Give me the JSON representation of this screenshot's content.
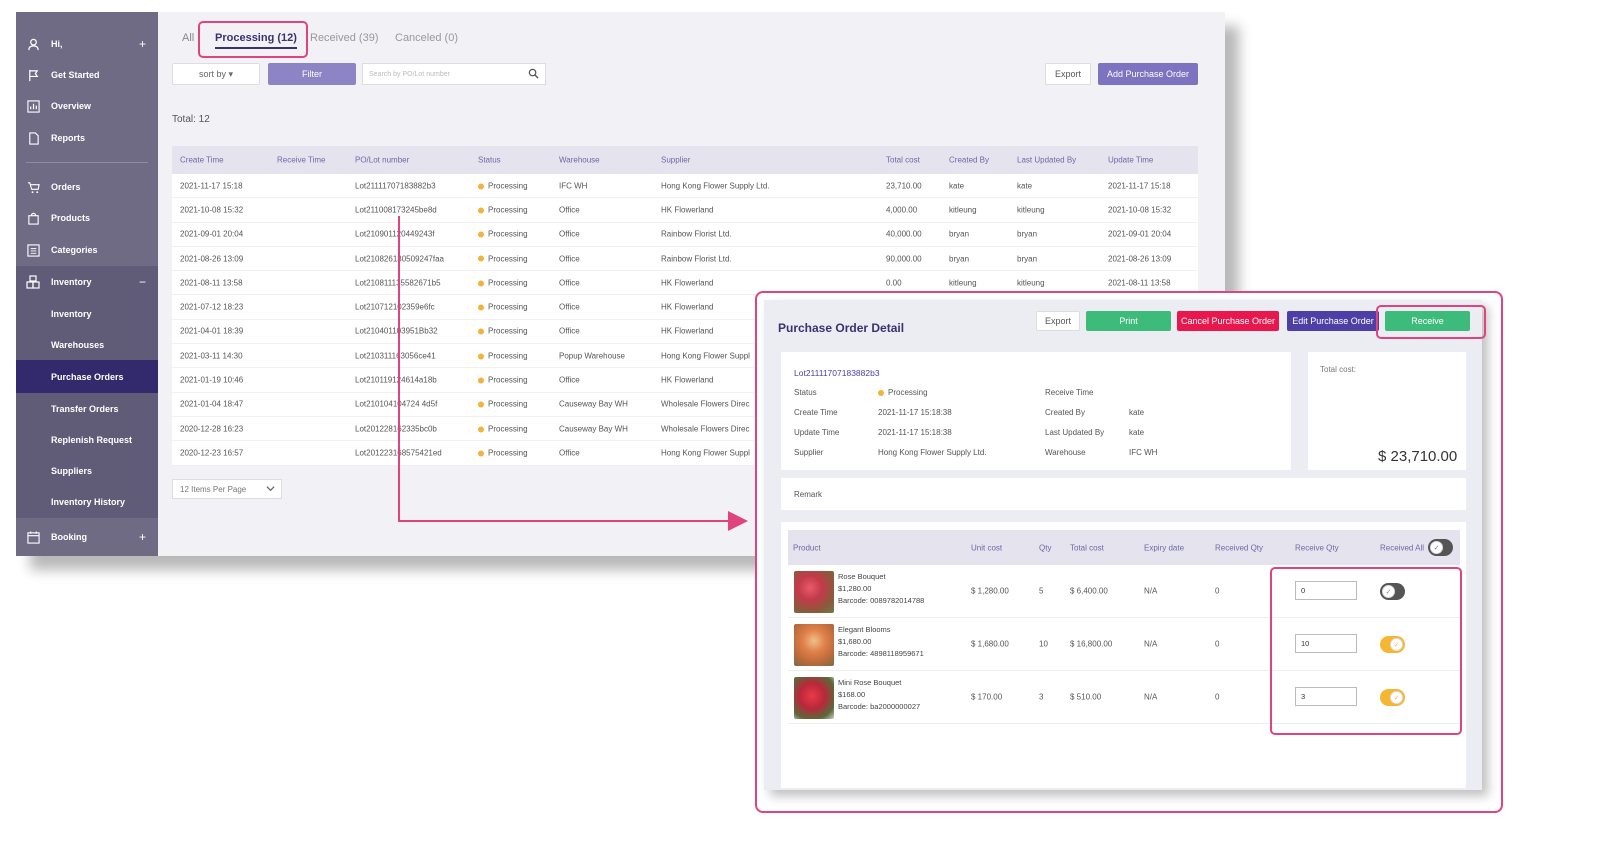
{
  "sidebar": {
    "items": [
      {
        "label": "Hi,",
        "icon": "user-icon",
        "plus": "+"
      },
      {
        "label": "Get Started",
        "icon": "flag-icon"
      },
      {
        "label": "Overview",
        "icon": "chart-icon"
      },
      {
        "label": "Reports",
        "icon": "document-icon"
      },
      {
        "label": "Orders",
        "icon": "cart-icon"
      },
      {
        "label": "Products",
        "icon": "bag-icon"
      },
      {
        "label": "Categories",
        "icon": "list-icon"
      },
      {
        "label": "Inventory",
        "icon": "boxes-icon",
        "minus": "−"
      }
    ],
    "subitems": [
      "Inventory",
      "Warehouses",
      "Purchase Orders",
      "Transfer Orders",
      "Replenish Request",
      "Suppliers",
      "Inventory History"
    ],
    "booking": {
      "label": "Booking",
      "plus": "+"
    }
  },
  "tabs": {
    "all": "All",
    "processing": "Processing (12)",
    "received": "Received (39)",
    "canceled": "Canceled (0)"
  },
  "toolbar": {
    "sort_label": "sort by ▾",
    "filter_label": "Filter",
    "search_placeholder": "Search by PO/Lot number",
    "export_label": "Export",
    "add_label": "Add Purchase Order"
  },
  "total_label": "Total: 12",
  "orders_table": {
    "headers": [
      "Create Time",
      "Receive Time",
      "PO/Lot number",
      "Status",
      "Warehouse",
      "Supplier",
      "Total cost",
      "Created By",
      "Last Updated By",
      "Update Time"
    ],
    "rows": [
      [
        "2021-11-17 15:18",
        "",
        "Lot21111707183882b3",
        "Processing",
        "IFC WH",
        "Hong Kong Flower Supply Ltd.",
        "23,710.00",
        "kate",
        "kate",
        "2021-11-17 15:18"
      ],
      [
        "2021-10-08 15:32",
        "",
        "Lot211008173245be8d",
        "Processing",
        "Office",
        "HK Flowerland",
        "4,000.00",
        "kitleung",
        "kitleung",
        "2021-10-08 15:32"
      ],
      [
        "2021-09-01 20:04",
        "",
        "Lot210901120449243f",
        "Processing",
        "Office",
        "Rainbow Florist Ltd.",
        "40,000.00",
        "bryan",
        "bryan",
        "2021-09-01 20:04"
      ],
      [
        "2021-08-26 13:09",
        "",
        "Lot210826130509247faa",
        "Processing",
        "Office",
        "Rainbow Florist Ltd.",
        "90,000.00",
        "bryan",
        "bryan",
        "2021-08-26 13:09"
      ],
      [
        "2021-08-11 13:58",
        "",
        "Lot210811135582671b5",
        "Processing",
        "Office",
        "HK Flowerland",
        "0.00",
        "kitleung",
        "kitleung",
        "2021-08-11 13:58"
      ],
      [
        "2021-07-12 18:23",
        "",
        "Lot210712102359e6fc",
        "Processing",
        "Office",
        "HK Flowerland",
        "",
        "",
        "",
        ""
      ],
      [
        "2021-04-01 18:39",
        "",
        "Lot210401103951Bb32",
        "Processing",
        "Office",
        "HK Flowerland",
        "",
        "",
        "",
        ""
      ],
      [
        "2021-03-11 14:30",
        "",
        "Lot210311163056ce41",
        "Processing",
        "Popup Warehouse",
        "Hong Kong Flower Suppl",
        "",
        "",
        "",
        ""
      ],
      [
        "2021-01-19 10:46",
        "",
        "Lot210119124614a18b",
        "Processing",
        "Office",
        "HK Flowerland",
        "",
        "",
        "",
        ""
      ],
      [
        "2021-01-04 18:47",
        "",
        "Lot210104104724 4d5f",
        "Processing",
        "Causeway Bay WH",
        "Wholesale Flowers Direc",
        "",
        "",
        "",
        ""
      ],
      [
        "2020-12-28 16:23",
        "",
        "Lot201228162335bc0b",
        "Processing",
        "Causeway Bay WH",
        "Wholesale Flowers Direc",
        "",
        "",
        "",
        ""
      ],
      [
        "2020-12-23 16:57",
        "",
        "Lot201223168575421ed",
        "Processing",
        "Office",
        "Hong Kong Flower Suppl",
        "",
        "",
        "",
        ""
      ]
    ]
  },
  "per_page_label": "12 Items Per Page",
  "detail": {
    "title": "Purchase Order Detail",
    "buttons": {
      "export": "Export",
      "print": "Print",
      "cancel": "Cancel Purchase Order",
      "edit": "Edit Purchase Order",
      "receive": "Receive"
    },
    "lot": "Lot21111707183882b3",
    "fields": {
      "status_label": "Status",
      "status_value": "Processing",
      "create_label": "Create Time",
      "create_value": "2021-11-17 15:18:38",
      "update_label": "Update Time",
      "update_value": "2021-11-17 15:18:38",
      "supplier_label": "Supplier",
      "supplier_value": "Hong Kong Flower Supply Ltd.",
      "receive_label": "Receive Time",
      "created_by_label": "Created By",
      "created_by_value": "kate",
      "updated_by_label": "Last Updated By",
      "updated_by_value": "kate",
      "warehouse_label": "Warehouse",
      "warehouse_value": "IFC WH"
    },
    "total_cost_label": "Total cost:",
    "total_cost_value": "$ 23,710.00",
    "remark_label": "Remark",
    "product_headers": [
      "Product",
      "Unit cost",
      "Qty",
      "Total cost",
      "Expiry date",
      "Received Qty",
      "Receive Qty",
      "Received All"
    ],
    "products": [
      {
        "name": "Rose Bouquet",
        "price": "$1,280.00",
        "barcode": "Barcode: 0089782014788",
        "unit_cost": "$ 1,280.00",
        "qty": "5",
        "total": "$ 6,400.00",
        "expiry": "N/A",
        "received": "0",
        "receive_qty": "0",
        "received_all": false
      },
      {
        "name": "Elegant Blooms",
        "price": "$1,680.00",
        "barcode": "Barcode: 4898118959671",
        "unit_cost": "$ 1,680.00",
        "qty": "10",
        "total": "$ 16,800.00",
        "expiry": "N/A",
        "received": "0",
        "receive_qty": "10",
        "received_all": true
      },
      {
        "name": "Mini Rose Bouquet",
        "price": "$168.00",
        "barcode": "Barcode: ba2000000027",
        "unit_cost": "$ 170.00",
        "qty": "3",
        "total": "$ 510.00",
        "expiry": "N/A",
        "received": "0",
        "receive_qty": "3",
        "received_all": true
      }
    ]
  },
  "colors": {
    "sidebar": "#706b85",
    "active": "#332a6e",
    "accent": "#4d3fa6",
    "highlight": "#e0447f",
    "green": "#3dbb7b",
    "red": "#e8174d",
    "toggle_on": "#f5b731"
  }
}
